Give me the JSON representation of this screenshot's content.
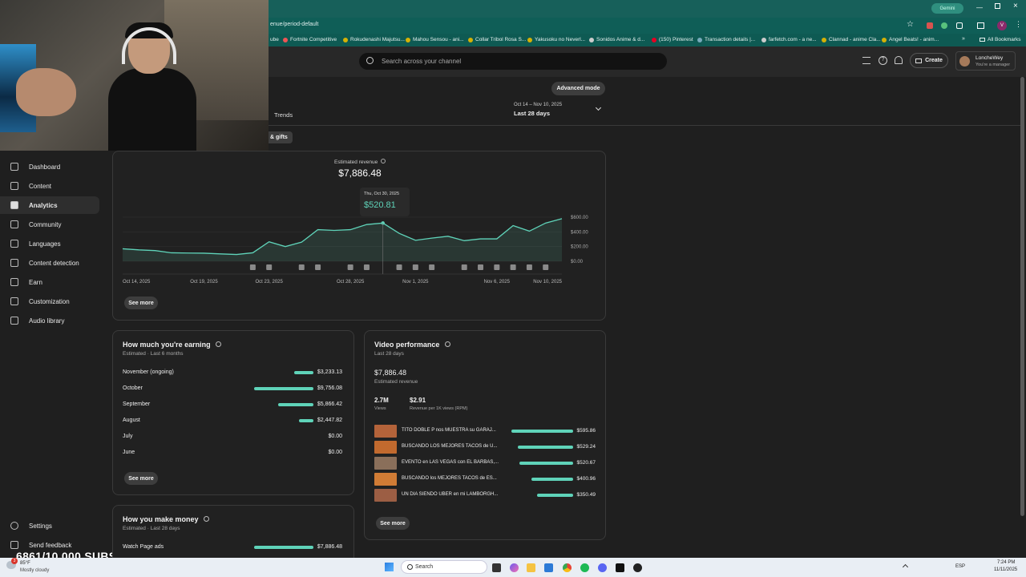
{
  "browser": {
    "url": "enue/period-default",
    "gemini_label": "Gemini",
    "profile_initial": "V",
    "bookmarks": [
      "ube",
      "Fortnite Competitive",
      "Rokudenashi Majutsu...",
      "Mahou Sensou - ani...",
      "Collar Tribol Rosa S...",
      "Yakusoku no Neverl...",
      "Sonidos Anime & d...",
      "(150) Pinterest",
      "Transaction details |...",
      "farfetch.com - a ne...",
      "Clannad - anime Cla...",
      "Angel Beats! - anim..."
    ],
    "all_bookmarks": "All Bookmarks"
  },
  "header": {
    "search_placeholder": "Search across your channel",
    "create_label": "Create",
    "account_name": "LoncheWey",
    "account_role": "You're a manager"
  },
  "toolbar": {
    "advanced_mode": "Advanced mode",
    "tab_trends": "Trends",
    "tab_gifts": "s & gifts",
    "period_range": "Oct 14 – Nov 10, 2025",
    "period_label": "Last 28 days"
  },
  "sidebar": {
    "items": [
      {
        "label": "Dashboard"
      },
      {
        "label": "Content"
      },
      {
        "label": "Analytics"
      },
      {
        "label": "Community"
      },
      {
        "label": "Languages"
      },
      {
        "label": "Content detection"
      },
      {
        "label": "Earn"
      },
      {
        "label": "Customization"
      },
      {
        "label": "Audio library"
      }
    ],
    "settings": "Settings",
    "feedback": "Send feedback"
  },
  "overlay": {
    "subs": "6861/10,000 SUBS"
  },
  "revenue": {
    "label": "Estimated revenue",
    "value": "$7,886.48",
    "tooltip_date": "Thu, Oct 30, 2025",
    "tooltip_value": "$520.81",
    "see_more": "See more"
  },
  "chart_data": {
    "type": "area",
    "x": [
      "Oct 14",
      "Oct 15",
      "Oct 16",
      "Oct 17",
      "Oct 18",
      "Oct 19",
      "Oct 20",
      "Oct 21",
      "Oct 22",
      "Oct 23",
      "Oct 24",
      "Oct 25",
      "Oct 26",
      "Oct 27",
      "Oct 28",
      "Oct 29",
      "Oct 30",
      "Oct 31",
      "Nov 1",
      "Nov 2",
      "Nov 3",
      "Nov 4",
      "Nov 5",
      "Nov 6",
      "Nov 7",
      "Nov 8",
      "Nov 9",
      "Nov 10"
    ],
    "values": [
      170,
      155,
      145,
      115,
      112,
      110,
      100,
      92,
      115,
      265,
      200,
      260,
      430,
      420,
      430,
      500,
      520,
      380,
      285,
      315,
      340,
      280,
      305,
      305,
      485,
      410,
      520,
      580
    ],
    "ylim": [
      0,
      600
    ],
    "y_ticks": [
      "$0.00",
      "$200.00",
      "$400.00",
      "$600.00"
    ],
    "x_tick_labels": [
      "Oct 14, 2025",
      "Oct 19, 2025",
      "Oct 23, 2025",
      "Oct 28, 2025",
      "Nov 1, 2025",
      "Nov 6, 2025",
      "Nov 10, 2025"
    ],
    "x_tick_index": [
      0,
      5,
      9,
      14,
      18,
      23,
      27
    ],
    "highlight_index": 16,
    "marker_index": [
      8,
      9,
      11,
      12,
      14,
      15,
      17,
      18,
      19,
      21,
      22,
      23,
      24,
      25,
      26
    ],
    "accent": "#5fd3b9"
  },
  "earning": {
    "title": "How much you're earning",
    "subtitle": "Estimated · Last 6 months",
    "rows": [
      {
        "label": "November (ongoing)",
        "value": "$3,233.13",
        "fraction": 0.33
      },
      {
        "label": "October",
        "value": "$9,756.08",
        "fraction": 1.0
      },
      {
        "label": "September",
        "value": "$5,866.42",
        "fraction": 0.6
      },
      {
        "label": "August",
        "value": "$2,447.82",
        "fraction": 0.25
      },
      {
        "label": "July",
        "value": "$0.00",
        "fraction": 0
      },
      {
        "label": "June",
        "value": "$0.00",
        "fraction": 0
      }
    ],
    "see_more": "See more"
  },
  "make_money": {
    "title": "How you make money",
    "subtitle": "Estimated · Last 28 days",
    "rows": [
      {
        "label": "Watch Page ads",
        "value": "$7,886.48",
        "fraction": 1.0
      }
    ]
  },
  "video_perf": {
    "title": "Video performance",
    "subtitle": "Last 28 days",
    "revenue_value": "$7,886.48",
    "revenue_label": "Estimated revenue",
    "views_value": "2.7M",
    "views_label": "Views",
    "rpm_value": "$2.91",
    "rpm_label": "Revenue per 1K views (RPM)",
    "videos": [
      {
        "title": "TITO DOBLE P nos MUESTRA su GARAJ...",
        "value": "$595.86",
        "fraction": 1.0
      },
      {
        "title": "BUSCANDO LOS MEJORES TACOS de U...",
        "value": "$529.24",
        "fraction": 0.89
      },
      {
        "title": "EVENTO en LAS VEGAS con EL BARBAS,...",
        "value": "$520.67",
        "fraction": 0.87
      },
      {
        "title": "BUSCANDO los MEJORES TACOS de ES...",
        "value": "$400.96",
        "fraction": 0.67
      },
      {
        "title": "UN DIA SIENDO UBER en mi LAMBORGH...",
        "value": "$350.49",
        "fraction": 0.59
      }
    ],
    "see_more": "See more"
  },
  "taskbar": {
    "weather_temp": "85°F",
    "weather_desc": "Mostly cloudy",
    "weather_badge": "3",
    "search_label": "Search",
    "lang": "ESP",
    "time": "7:24 PM",
    "date": "11/11/2025"
  }
}
